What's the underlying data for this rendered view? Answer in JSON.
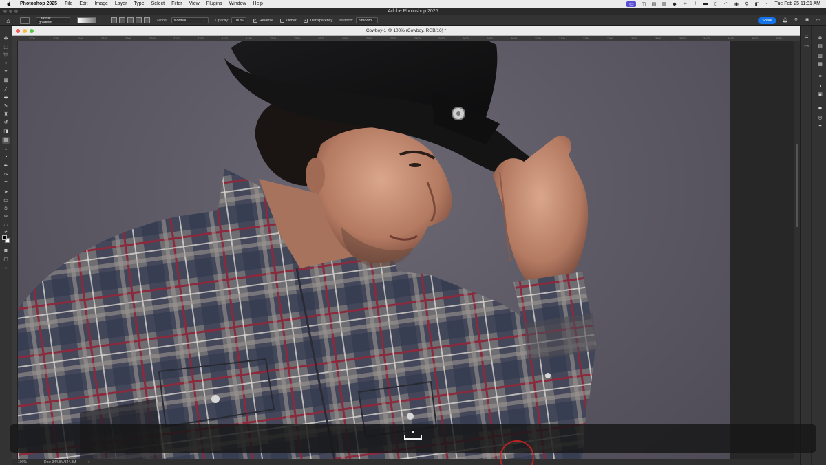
{
  "menubar": {
    "app_name": "Photoshop 2025",
    "items": [
      "File",
      "Edit",
      "Image",
      "Layer",
      "Type",
      "Select",
      "Filter",
      "View",
      "Plugins",
      "Window",
      "Help"
    ],
    "clock": "Tue Feb 25  11:31 AM"
  },
  "window": {
    "title": "Adobe Photoshop 2025"
  },
  "options": {
    "gradient_preset": "Classic gradient",
    "mode_label": "Mode:",
    "mode_value": "Normal",
    "opacity_label": "Opacity:",
    "opacity_value": "100%",
    "reverse_label": "Reverse",
    "dither_label": "Dither",
    "transparency_label": "Transparency",
    "method_label": "Method:",
    "method_value": "Smooth",
    "share_label": "Share",
    "reverse_checked": true,
    "dither_checked": false,
    "transparency_checked": true
  },
  "document": {
    "title": "Cowboy-1 @ 100% (Cowboy, RGB/16) *",
    "ruler_ticks": [
      "2000",
      "2050",
      "2100",
      "2150",
      "2200",
      "2250",
      "2300",
      "2350",
      "2400",
      "2450",
      "2500",
      "2550",
      "2600",
      "2650",
      "2700",
      "2750",
      "2800",
      "2850",
      "2900",
      "2950",
      "3000",
      "3050",
      "3100",
      "3150",
      "3200",
      "3250",
      "3300",
      "3350",
      "3400",
      "3450",
      "3500",
      "3550",
      "3600"
    ],
    "zoom": "100%",
    "doc_size": "Doc: 344.8M/344.8M",
    "status_arrow": ">"
  },
  "colors": {
    "accent": "#1473e6",
    "focus_icon_bg": "#5b4fd6",
    "cursor_ring": "#d02020"
  },
  "icons": {
    "left_tools": [
      "move-icon",
      "marquee-icon",
      "lasso-icon",
      "object-select-icon",
      "crop-icon",
      "frame-icon",
      "eyedropper-icon",
      "spot-heal-icon",
      "brush-icon",
      "clone-stamp-icon",
      "history-brush-icon",
      "eraser-icon",
      "gradient-icon",
      "blur-icon",
      "dodge-icon",
      "pen-icon",
      "type-icon",
      "path-select-icon",
      "rectangle-icon",
      "hand-icon",
      "zoom-icon",
      "more-tools-icon"
    ],
    "right_panels": [
      "properties-icon",
      "layers-icon",
      "adjustments-icon",
      "libraries-icon",
      "channels-icon",
      "paths-icon",
      "color-icon",
      "swatches-icon",
      "history-icon"
    ]
  }
}
